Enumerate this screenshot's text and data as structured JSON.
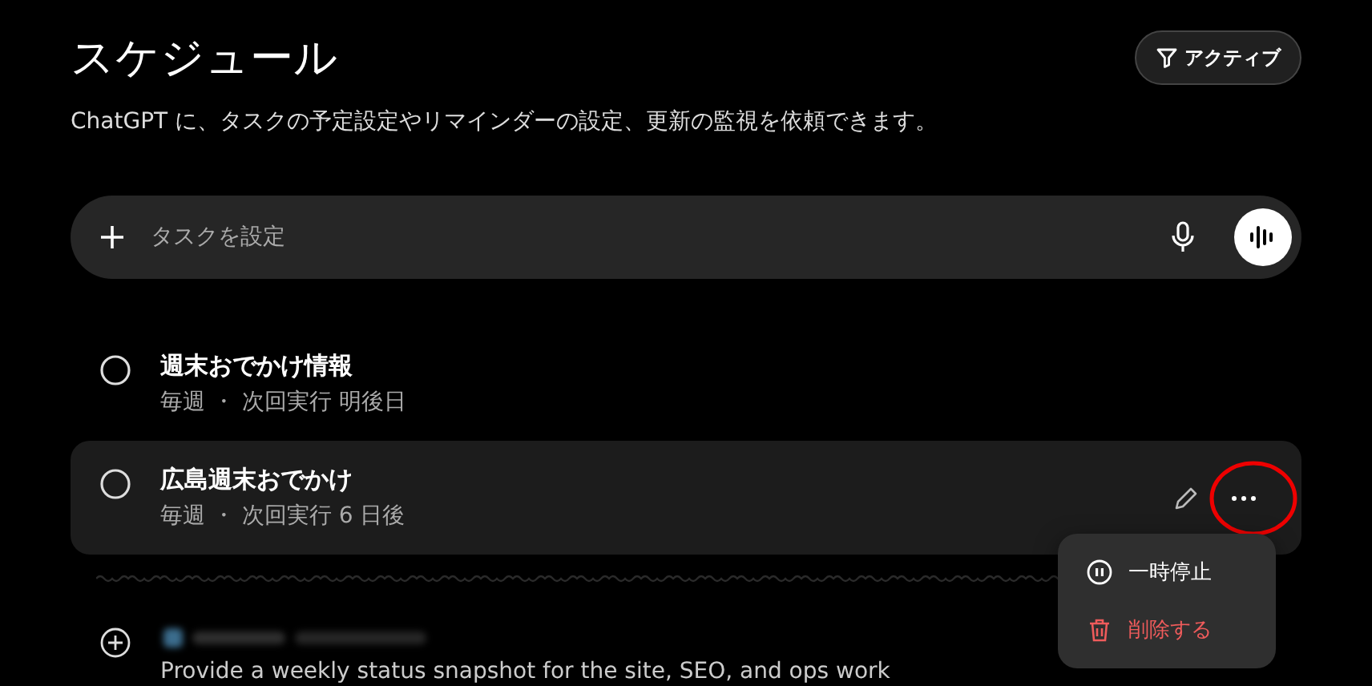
{
  "header": {
    "title": "スケジュール",
    "subtitle": "ChatGPT に、タスクの予定設定やリマインダーの設定、更新の監視を依頼できます。",
    "filter_button": "アクティブ"
  },
  "composer": {
    "placeholder": "タスクを設定"
  },
  "tasks": [
    {
      "kind": "scheduled",
      "title": "週末おでかけ情報",
      "schedule": "毎週 ・ 次回実行 明後日",
      "selected": false
    },
    {
      "kind": "scheduled",
      "title": "広島週末おでかけ",
      "schedule": "毎週 ・ 次回実行 6 日後",
      "selected": true
    },
    {
      "kind": "suggested",
      "description": "Provide a weekly status snapshot for the site, SEO, and ops work",
      "selected": false
    }
  ],
  "menu": {
    "items": [
      {
        "kind": "pause",
        "label": "一時停止"
      },
      {
        "kind": "delete",
        "label": "削除する"
      }
    ]
  }
}
